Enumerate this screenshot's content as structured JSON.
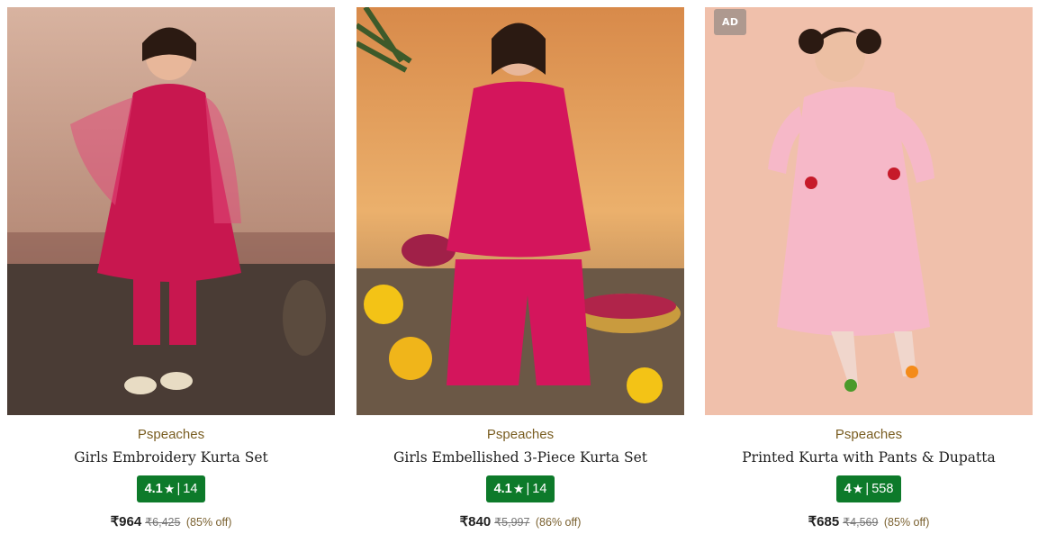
{
  "products": [
    {
      "brand": "Pspeaches",
      "title": "Girls Embroidery Kurta Set",
      "rating": "4.1",
      "rating_star": "★",
      "rating_count": "14",
      "price": "₹964",
      "mrp": "₹6,425",
      "discount": "(85% off)",
      "is_ad": false,
      "colors": {
        "bg": "#c9a08c",
        "dress": "#c8174f"
      }
    },
    {
      "brand": "Pspeaches",
      "title": "Girls Embellished 3-Piece Kurta Set",
      "rating": "4.1",
      "rating_star": "★",
      "rating_count": "14",
      "price": "₹840",
      "mrp": "₹5,997",
      "discount": "(86% off)",
      "is_ad": false,
      "colors": {
        "bg": "#e6a45a",
        "dress": "#d4155c"
      }
    },
    {
      "brand": "Pspeaches",
      "title": "Printed Kurta with Pants & Dupatta",
      "rating": "4",
      "rating_star": "★",
      "rating_count": "558",
      "price": "₹685",
      "mrp": "₹4,569",
      "discount": "(85% off)",
      "is_ad": true,
      "ad_label": "AD",
      "colors": {
        "bg": "#f1c2ae",
        "dress": "#f6b8c8"
      }
    }
  ],
  "separator": "|",
  "accent": {
    "rating_bg": "#0d7a2a",
    "brand_color": "#7a5e22"
  }
}
